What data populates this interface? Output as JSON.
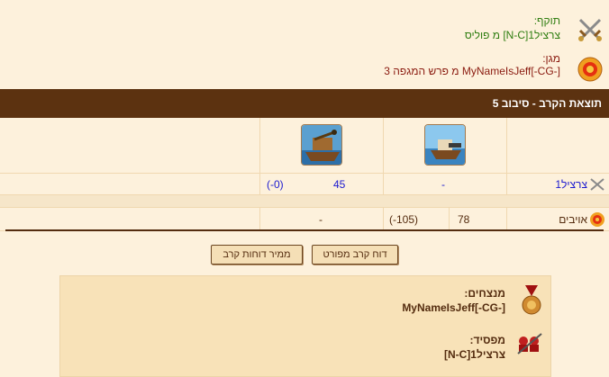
{
  "attacker": {
    "label": "תוקף:",
    "value": "צרציל1[N-C] מ פוליס",
    "icon": "crossed-swords-icon"
  },
  "defender": {
    "label": "מגן:",
    "value": "MyNameIsJeff[-CG-] מ פרש המגפה 3",
    "icon": "shield-target-icon"
  },
  "round_title": "תוצאת הקרב - סיבוב 5",
  "units": [
    {
      "name": "ship-cannon-unit",
      "icon": "cannon-ship-icon"
    },
    {
      "name": "ship-catapult-unit",
      "icon": "catapult-ship-icon"
    }
  ],
  "rows": {
    "mine": {
      "label": "צרציל1",
      "col1": "-",
      "col2_count": "45",
      "col2_loss": "(-0)"
    },
    "enemy": {
      "label": "אויבים",
      "col1_count": "78",
      "col1_loss": "(-105)",
      "col2": "-"
    }
  },
  "buttons": {
    "detailed_report": "דוח קרב מפורט",
    "battle_reports_converter": "ממיר דוחות קרב"
  },
  "summary": {
    "winners_label": "מנצחים:",
    "winners_value": "MyNameIsJeff[-CG-]",
    "loser_label": "מפסיד:",
    "loser_value": "צרציל1[N-C]"
  },
  "colors": {
    "background": "#fdf1dc",
    "header_bar": "#5c3210",
    "attacker_text": "#2e7d10",
    "defender_text": "#8a1a0f",
    "numbers": "#1c1ad0"
  }
}
